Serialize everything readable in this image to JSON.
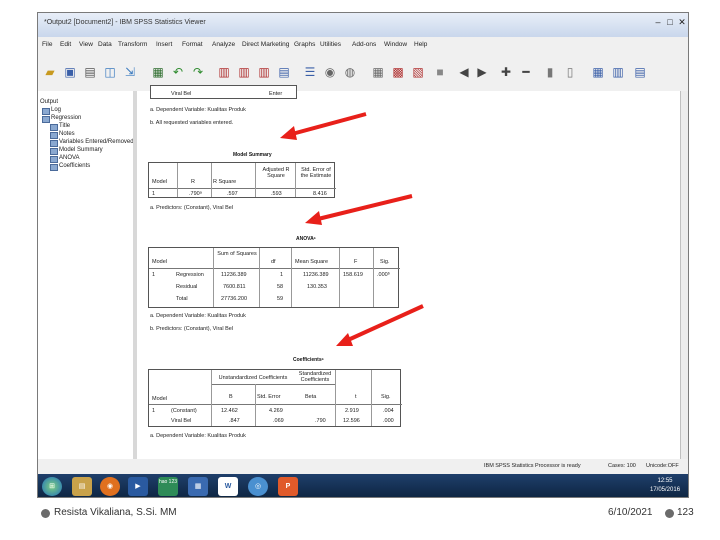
{
  "window": {
    "title": "*Output2 [Document2] - IBM SPSS Statistics Viewer",
    "buttons": {
      "minimize": "–",
      "restore": "□",
      "close": "✕"
    }
  },
  "menu": [
    "File",
    "Edit",
    "View",
    "Data",
    "Transform",
    "Insert",
    "Format",
    "Analyze",
    "Direct Marketing",
    "Graphs",
    "Utilities",
    "Add-ons",
    "Window",
    "Help"
  ],
  "nav": {
    "items": [
      "Output",
      "Log",
      "Regression",
      "Title",
      "Notes",
      "Variables Entered/Removed",
      "Model Summary",
      "ANOVA",
      "Coefficients"
    ]
  },
  "output": {
    "top_fragment": {
      "col1": "Viral Bel",
      "col2": "Enter"
    },
    "notes_top": [
      "a. Dependent Variable: Kualitas Produk",
      "b. All requested variables entered."
    ],
    "model_summary": {
      "title": "Model Summary",
      "headers": [
        "Model",
        "R",
        "R Square",
        "Adjusted R Square",
        "Std. Error of the Estimate"
      ],
      "row": [
        "1",
        ".790ᵃ",
        ".597",
        ".593",
        "8.416"
      ],
      "note": "a. Predictors: (Constant), Viral Bel"
    },
    "anova": {
      "title": "ANOVAᵃ",
      "headers": [
        "Model",
        "",
        "Sum of Squares",
        "df",
        "Mean Square",
        "F",
        "Sig."
      ],
      "rows": [
        [
          "1",
          "Regression",
          "11236.389",
          "1",
          "11236.389",
          "158.619",
          ".000ᵇ"
        ],
        [
          "",
          "Residual",
          "7600.811",
          "58",
          "130.353",
          "",
          ""
        ],
        [
          "",
          "Total",
          "27736.200",
          "59",
          "",
          "",
          ""
        ]
      ],
      "notes": [
        "a. Dependent Variable: Kualitas Produk",
        "b. Predictors: (Constant), Viral Bel"
      ]
    },
    "coefficients": {
      "title": "Coefficientsᵃ",
      "group_headers": [
        "Unstandardized Coefficients",
        "Standardized Coefficients"
      ],
      "headers": [
        "Model",
        "",
        "B",
        "Std. Error",
        "Beta",
        "t",
        "Sig."
      ],
      "rows": [
        [
          "1",
          "(Constant)",
          "12.462",
          "4.269",
          "",
          "2.919",
          ".004"
        ],
        [
          "",
          "Viral Bel",
          ".847",
          ".069",
          ".790",
          "12.596",
          ".000"
        ]
      ],
      "note": "a. Dependent Variable: Kualitas Produk"
    }
  },
  "status": {
    "processor": "IBM SPSS Statistics Processor is ready",
    "cases": "Cases: 100",
    "unicode": "Unicode:OFF"
  },
  "taskbar": {
    "time": "12:55",
    "date": "17/05/2016",
    "icons": [
      "windows-start-icon",
      "explorer-icon",
      "firefox-icon",
      "media-icon",
      "hao123-icon",
      "spss-icon",
      "word-icon",
      "chrome-icon",
      "powerpoint-icon"
    ],
    "hao_label": "hao 123"
  },
  "arrow_color": "#e8201a",
  "footer": {
    "author": "Resista Vikaliana, S.Si. MM",
    "date": "6/10/2021",
    "page": "123"
  }
}
